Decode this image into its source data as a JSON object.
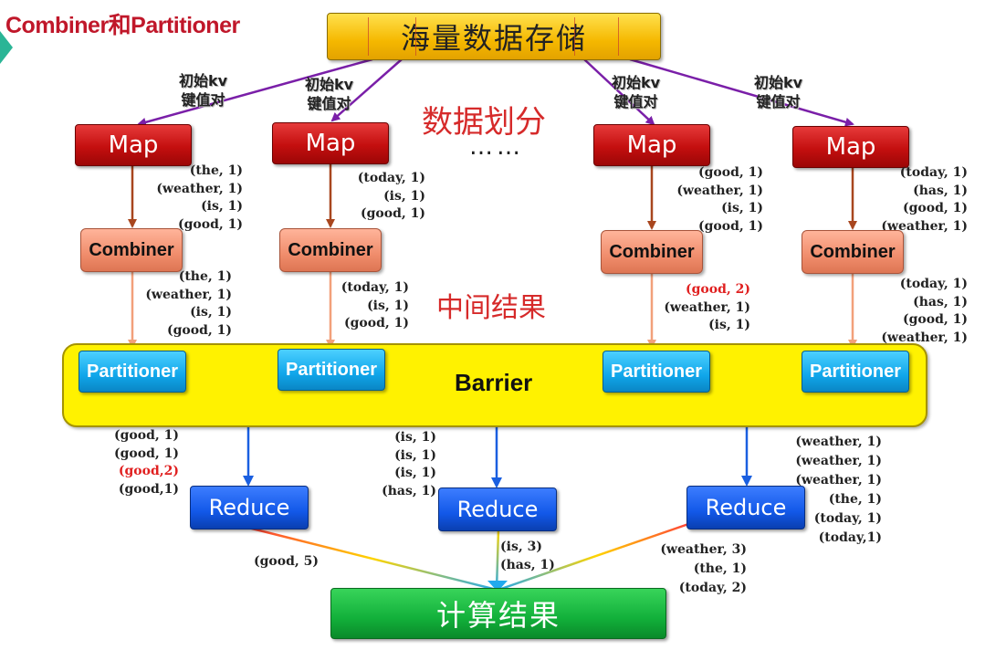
{
  "title": "Combiner和Partitioner",
  "storage_label": "海量数据存储",
  "kv_label_lines": [
    "初始kv",
    "键值对"
  ],
  "split_label": "数据划分",
  "ellipsis": "……",
  "intermediate_label": "中间结果",
  "barrier_label": "Barrier",
  "result_label": "计算结果",
  "map_label": "Map",
  "combiner_label": "Combiner",
  "partitioner_label": "Partitioner",
  "reduce_label": "Reduce",
  "map_outputs": [
    [
      "(the, 1)",
      "(weather, 1)",
      "(is, 1)",
      "(good, 1)"
    ],
    [
      "(today, 1)",
      "(is, 1)",
      "(good, 1)"
    ],
    [
      "(good, 1)",
      "(weather, 1)",
      "(is, 1)",
      "(good, 1)"
    ],
    [
      "(today, 1)",
      "(has, 1)",
      "(good, 1)",
      "(weather, 1)"
    ]
  ],
  "combiner_outputs": [
    [
      "(the, 1)",
      "(weather, 1)",
      "(is, 1)",
      "(good, 1)"
    ],
    [
      "(today, 1)",
      "(is, 1)",
      "(good, 1)"
    ],
    [
      "(good, 2)",
      "(weather, 1)",
      "(is, 1)"
    ],
    [
      "(today, 1)",
      "(has, 1)",
      "(good, 1)",
      "(weather, 1)"
    ]
  ],
  "combiner_highlight": [
    [],
    [],
    [
      0
    ],
    []
  ],
  "reduce_inputs": [
    [
      "(good, 1)",
      "(good, 1)",
      "(good,2)",
      "(good,1)"
    ],
    [
      "(is, 1)",
      "(is, 1)",
      "(is, 1)",
      "(has, 1)"
    ],
    [
      "(weather, 1)",
      "(weather, 1)",
      "(weather, 1)",
      "(the, 1)",
      "(today, 1)",
      "(today,1)"
    ]
  ],
  "reduce_input_highlight": [
    [
      2
    ],
    [],
    []
  ],
  "reduce_outputs": [
    [
      "(good, 5)"
    ],
    [
      "(is, 3)",
      "(has, 1)"
    ],
    [
      "(weather, 3)",
      "(the, 1)",
      "(today, 2)"
    ]
  ],
  "colors": {
    "title": "#c0172a",
    "split_arrows": "#7a1fa8",
    "map_to_combiner": "#a8461e",
    "combiner_to_partitioner": "#f2a07a",
    "shuffle": "#a8461e",
    "to_reduce": "#1a5fe0",
    "highlight": "#e01f1f"
  }
}
